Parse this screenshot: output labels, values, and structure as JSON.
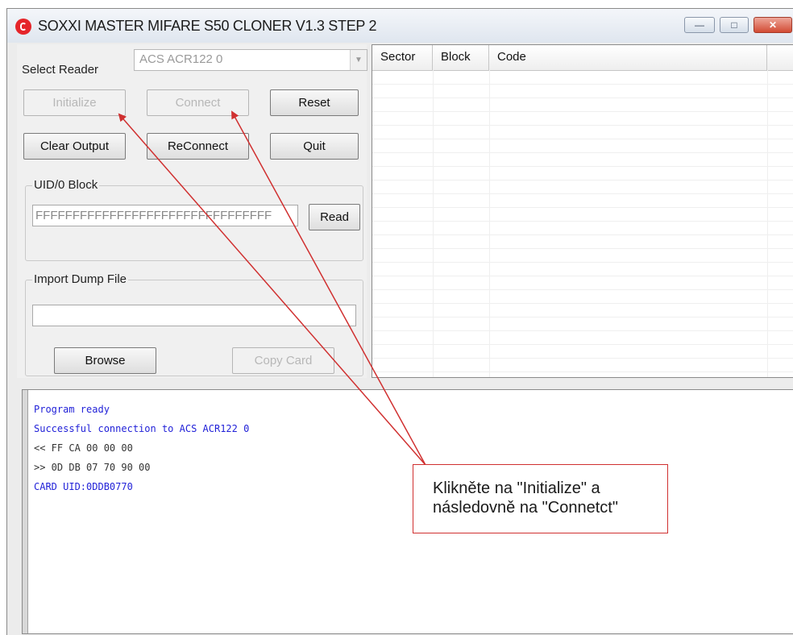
{
  "window": {
    "title": "SOXXI MASTER MIFARE S50 CLONER  V1.3  STEP 2"
  },
  "controls": {
    "minimize": "—",
    "maximize": "□",
    "close": "✕"
  },
  "reader": {
    "label": "Select Reader",
    "selected": "ACS ACR122 0"
  },
  "buttons": {
    "initialize": "Initialize",
    "connect": "Connect",
    "reset": "Reset",
    "clear_output": "Clear Output",
    "reconnect": "ReConnect",
    "quit": "Quit",
    "read": "Read",
    "browse": "Browse",
    "copy_card": "Copy Card"
  },
  "uid_block": {
    "title": "UID/0 Block",
    "value": "FFFFFFFFFFFFFFFFFFFFFFFFFFFFFFFF"
  },
  "import_dump": {
    "title": "Import Dump File",
    "value": ""
  },
  "grid": {
    "headers": [
      "Sector",
      "Block",
      "Code"
    ]
  },
  "log": [
    {
      "text": "Program ready",
      "color": "#2222d8"
    },
    {
      "text": "Successful connection to ACS ACR122 0",
      "color": "#2222d8"
    },
    {
      "text": "<< FF CA 00 00 00",
      "color": "#333333"
    },
    {
      "text": ">> 0D DB 07 70 90 00",
      "color": "#333333"
    },
    {
      "text": "CARD UID:0DDB0770",
      "color": "#2222d8"
    }
  ],
  "annotation": {
    "line1": "Klikněte na \"Initialize\" a",
    "line2": "následovně na \"Connetct\"",
    "color": "#d03030"
  }
}
